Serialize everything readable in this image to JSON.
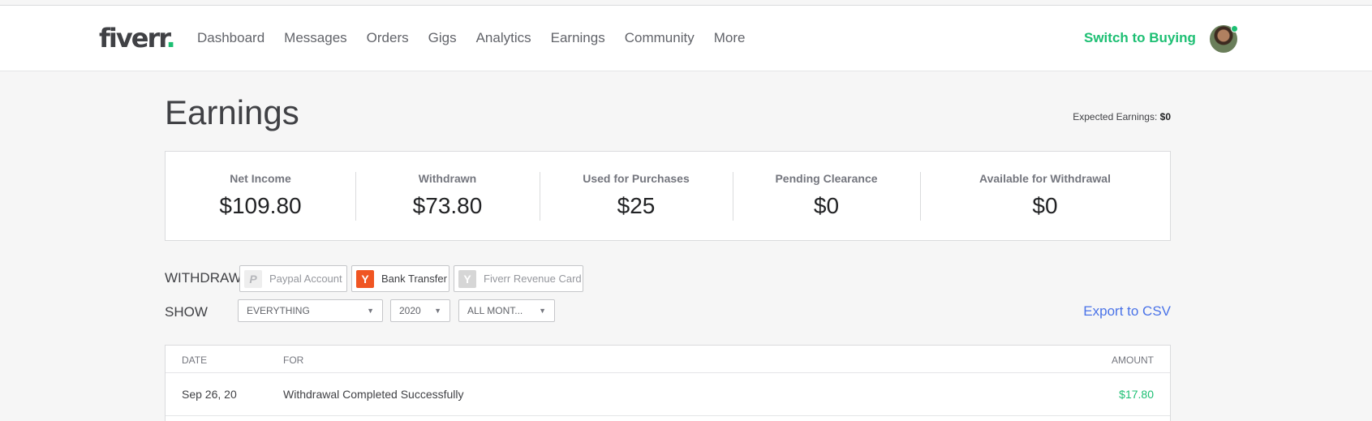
{
  "brand": {
    "name": "fiverr",
    "dot": "."
  },
  "nav": {
    "items": [
      "Dashboard",
      "Messages",
      "Orders",
      "Gigs",
      "Analytics",
      "Earnings",
      "Community",
      "More"
    ],
    "switch_label": "Switch to Buying"
  },
  "page": {
    "title": "Earnings",
    "expected_label": "Expected Earnings: ",
    "expected_value": "$0"
  },
  "stats": [
    {
      "label": "Net Income",
      "value": "$109.80"
    },
    {
      "label": "Withdrawn",
      "value": "$73.80"
    },
    {
      "label": "Used for Purchases",
      "value": "$25"
    },
    {
      "label": "Pending Clearance",
      "value": "$0"
    },
    {
      "label": "Available for Withdrawal",
      "value": "$0"
    }
  ],
  "withdraw": {
    "label": "WITHDRAW",
    "options": [
      {
        "label": "Paypal Account",
        "icon": "paypal-icon",
        "enabled": false
      },
      {
        "label": "Bank Transfer",
        "icon": "bank-transfer-icon",
        "enabled": true
      },
      {
        "label": "Fiverr Revenue Card",
        "icon": "revenue-card-icon",
        "enabled": false
      }
    ]
  },
  "filters": {
    "label": "SHOW",
    "type": "EVERYTHING",
    "year": "2020",
    "month": "ALL MONT...",
    "export_label": "Export to CSV"
  },
  "table": {
    "headers": {
      "date": "DATE",
      "for": "FOR",
      "amount": "AMOUNT"
    },
    "rows": [
      {
        "date": "Sep 26, 20",
        "for": "Withdrawal Completed Successfully",
        "amount": "$17.80"
      }
    ]
  },
  "colors": {
    "accent": "#1dbf73",
    "link": "#4a73e8",
    "bank": "#f05522"
  }
}
